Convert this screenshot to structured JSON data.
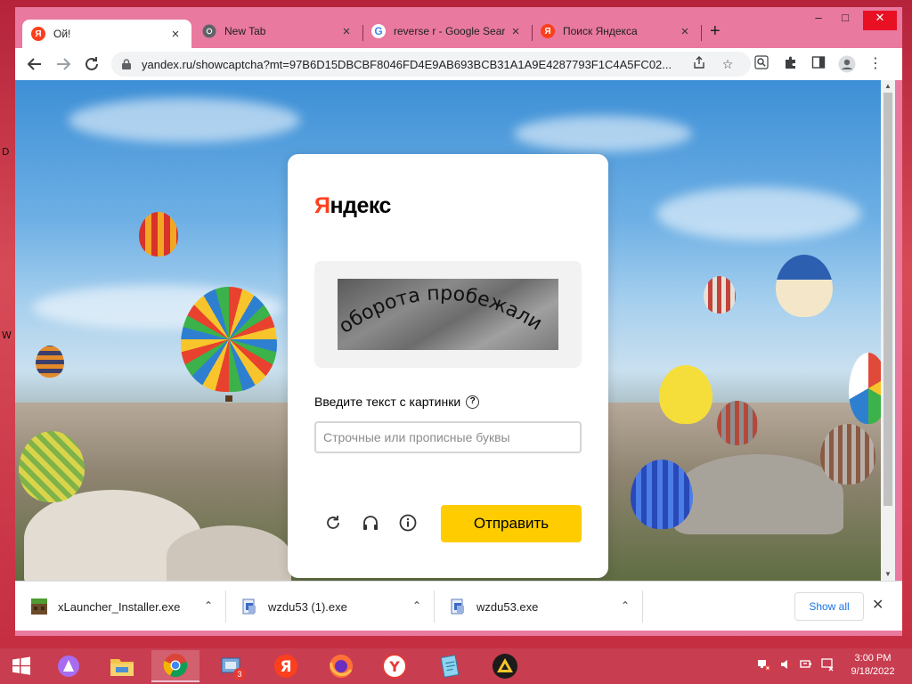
{
  "browser": {
    "tabs": [
      {
        "label": "Ой!",
        "favicon": "yandex-icon",
        "active": true
      },
      {
        "label": "New Tab",
        "favicon": "chrome-icon",
        "active": false
      },
      {
        "label": "reverse r - Google Sear",
        "favicon": "google-icon",
        "active": false
      },
      {
        "label": "Поиск Яндекса",
        "favicon": "yandex-icon",
        "active": false
      }
    ],
    "new_tab": "+",
    "url": "yandex.ru/showcaptcha?mt=97B6D15DBCBF8046FD4E9AB693BCB31A1A9E4287793F1C4A5FC02...",
    "window_controls": {
      "minimize": "–",
      "maximize": "□",
      "close": "✕"
    }
  },
  "captcha": {
    "logo": {
      "first": "Я",
      "rest": "ндекс"
    },
    "image_text": "оборота пробежали",
    "prompt": "Введите текст с картинки",
    "help": "?",
    "input": {
      "value": "",
      "placeholder": "Строчные или прописные буквы"
    },
    "submit": "Отправить",
    "icons": [
      "refresh-icon",
      "audio-icon",
      "info-icon"
    ]
  },
  "downloads": {
    "items": [
      {
        "name": "xLauncher_Installer.exe",
        "icon": "minecraft-icon"
      },
      {
        "name": "wzdu53 (1).exe",
        "icon": "installer-icon"
      },
      {
        "name": "wzdu53.exe",
        "icon": "installer-icon"
      }
    ],
    "show_all": "Show all",
    "close": "✕"
  },
  "taskbar": {
    "apps": [
      "start-icon",
      "alice-icon",
      "file-explorer-icon",
      "chrome-icon",
      "network-tool-icon",
      "yandex-icon",
      "firefox-icon",
      "yandex-browser-icon",
      "notepad-icon",
      "archicad-icon"
    ],
    "badge": "3",
    "clock": {
      "time": "3:00 PM",
      "date": "9/18/2022"
    }
  },
  "desktop": {
    "letters": [
      "D",
      "W"
    ]
  },
  "colors": {
    "yandex_red": "#fc3f1d",
    "yandex_yellow": "#ffcc00",
    "chrome_frame": "#e9799e",
    "taskbar": "#c83d50"
  }
}
